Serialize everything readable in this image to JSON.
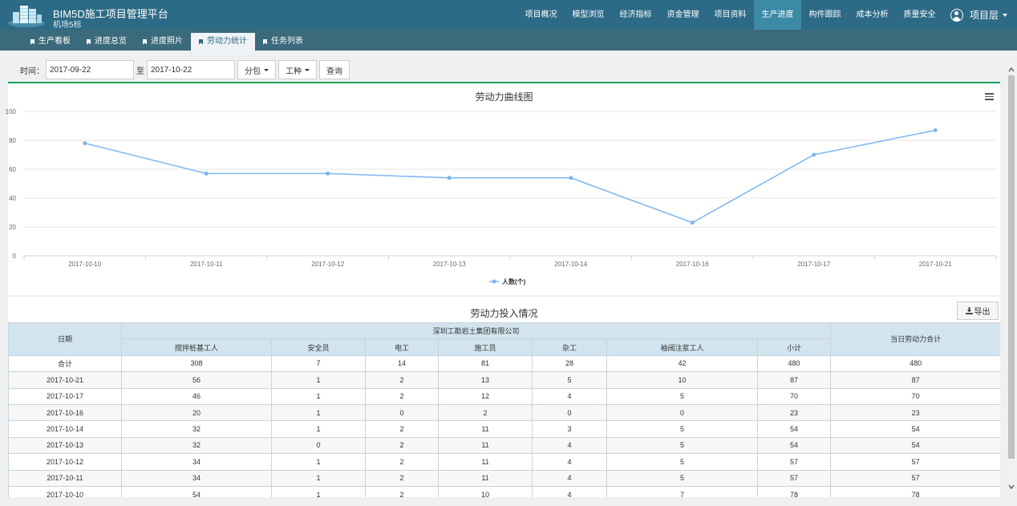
{
  "app": {
    "title": "BIM5D施工项目管理平台",
    "subtitle": "机场5标"
  },
  "topnav": {
    "items": [
      "项目概况",
      "模型浏览",
      "经济指标",
      "资金管理",
      "项目资料",
      "生产进度",
      "构件跟踪",
      "成本分析",
      "质量安全"
    ],
    "active_index": 5
  },
  "user": {
    "label": "项目层"
  },
  "subnav": {
    "items": [
      "生产看板",
      "进度总览",
      "进度照片",
      "劳动力统计",
      "任务列表"
    ],
    "active_index": 3
  },
  "filter": {
    "time_label": "时间：",
    "start_date": "2017-09-22",
    "to_label": "至",
    "end_date": "2017-10-22",
    "subcontract_label": "分包",
    "worktype_label": "工种",
    "query_label": "查询"
  },
  "chart_data": {
    "type": "line",
    "title": "劳动力曲线图",
    "categories": [
      "2017-10-10",
      "2017-10-11",
      "2017-10-12",
      "2017-10-13",
      "2017-10-14",
      "2017-10-16",
      "2017-10-17",
      "2017-10-21"
    ],
    "series": [
      {
        "name": "人数(个)",
        "values": [
          78,
          57,
          57,
          54,
          54,
          23,
          70,
          87
        ]
      }
    ],
    "ylim": [
      0,
      100
    ],
    "yticks": [
      0,
      20,
      40,
      60,
      80,
      100
    ],
    "legend": "bottom-center",
    "grid": true,
    "color": "#7cb5ec"
  },
  "table": {
    "title": "劳动力投入情况",
    "export_label": "导出",
    "date_header": "日期",
    "company_header": "深圳工勘岩土集团有限公司",
    "total_header": "当日劳动力合计",
    "columns": [
      "搅拌桩基工人",
      "安全员",
      "电工",
      "施工员",
      "杂工",
      "袖阀注浆工人",
      "小计"
    ],
    "sum_row": [
      "合计",
      "308",
      "7",
      "14",
      "81",
      "28",
      "42",
      "480",
      "480"
    ],
    "rows": [
      [
        "2017-10-21",
        "56",
        "1",
        "2",
        "13",
        "5",
        "10",
        "87",
        "87"
      ],
      [
        "2017-10-17",
        "46",
        "1",
        "2",
        "12",
        "4",
        "5",
        "70",
        "70"
      ],
      [
        "2017-10-16",
        "20",
        "1",
        "0",
        "2",
        "0",
        "0",
        "23",
        "23"
      ],
      [
        "2017-10-14",
        "32",
        "1",
        "2",
        "11",
        "3",
        "5",
        "54",
        "54"
      ],
      [
        "2017-10-13",
        "32",
        "0",
        "2",
        "11",
        "4",
        "5",
        "54",
        "54"
      ],
      [
        "2017-10-12",
        "34",
        "1",
        "2",
        "11",
        "4",
        "5",
        "57",
        "57"
      ],
      [
        "2017-10-11",
        "34",
        "1",
        "2",
        "11",
        "4",
        "5",
        "57",
        "57"
      ],
      [
        "2017-10-10",
        "54",
        "1",
        "2",
        "10",
        "4",
        "7",
        "78",
        "78"
      ]
    ]
  }
}
